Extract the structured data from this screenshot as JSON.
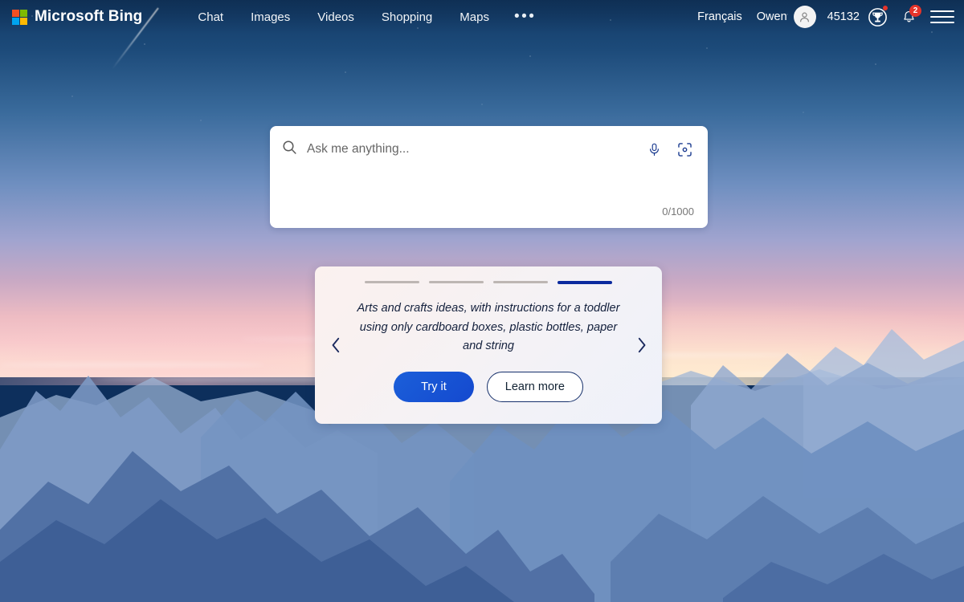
{
  "brand": {
    "name": "Microsoft Bing",
    "logo_icon": "microsoft-logo-icon"
  },
  "nav": {
    "items": [
      {
        "label": "Chat"
      },
      {
        "label": "Images"
      },
      {
        "label": "Videos"
      },
      {
        "label": "Shopping"
      },
      {
        "label": "Maps"
      }
    ],
    "more_label": "•••"
  },
  "header_right": {
    "language": "Français",
    "username": "Owen",
    "avatar_icon": "person-avatar-icon",
    "rewards_points": "45132",
    "rewards_icon": "trophy-rewards-icon",
    "notifications_icon": "bell-icon",
    "notifications_count": "2",
    "menu_icon": "hamburger-menu-icon"
  },
  "search": {
    "placeholder": "Ask me anything...",
    "value": "",
    "search_icon": "search-magnifier-icon",
    "mic_icon": "microphone-icon",
    "visual_icon": "visual-search-camera-icon",
    "counter": "0/1000"
  },
  "carousel": {
    "slides_total": 4,
    "active_index": 3,
    "prompt": "Arts and crafts ideas, with instructions for a toddler using only cardboard boxes, plastic bottles, paper and string",
    "primary_button": "Try it",
    "secondary_button": "Learn more",
    "prev_icon": "chevron-left-icon",
    "next_icon": "chevron-right-icon"
  },
  "colors": {
    "accent_blue": "#1449cf",
    "active_bar": "#0b2a9e",
    "badge_red": "#e5342a",
    "logo_red": "#f25022",
    "logo_green": "#7fba00",
    "logo_blue": "#00a4ef",
    "logo_yellow": "#ffb900",
    "sky_top": "#123a66",
    "sky_horizon": "#fce5d8"
  }
}
